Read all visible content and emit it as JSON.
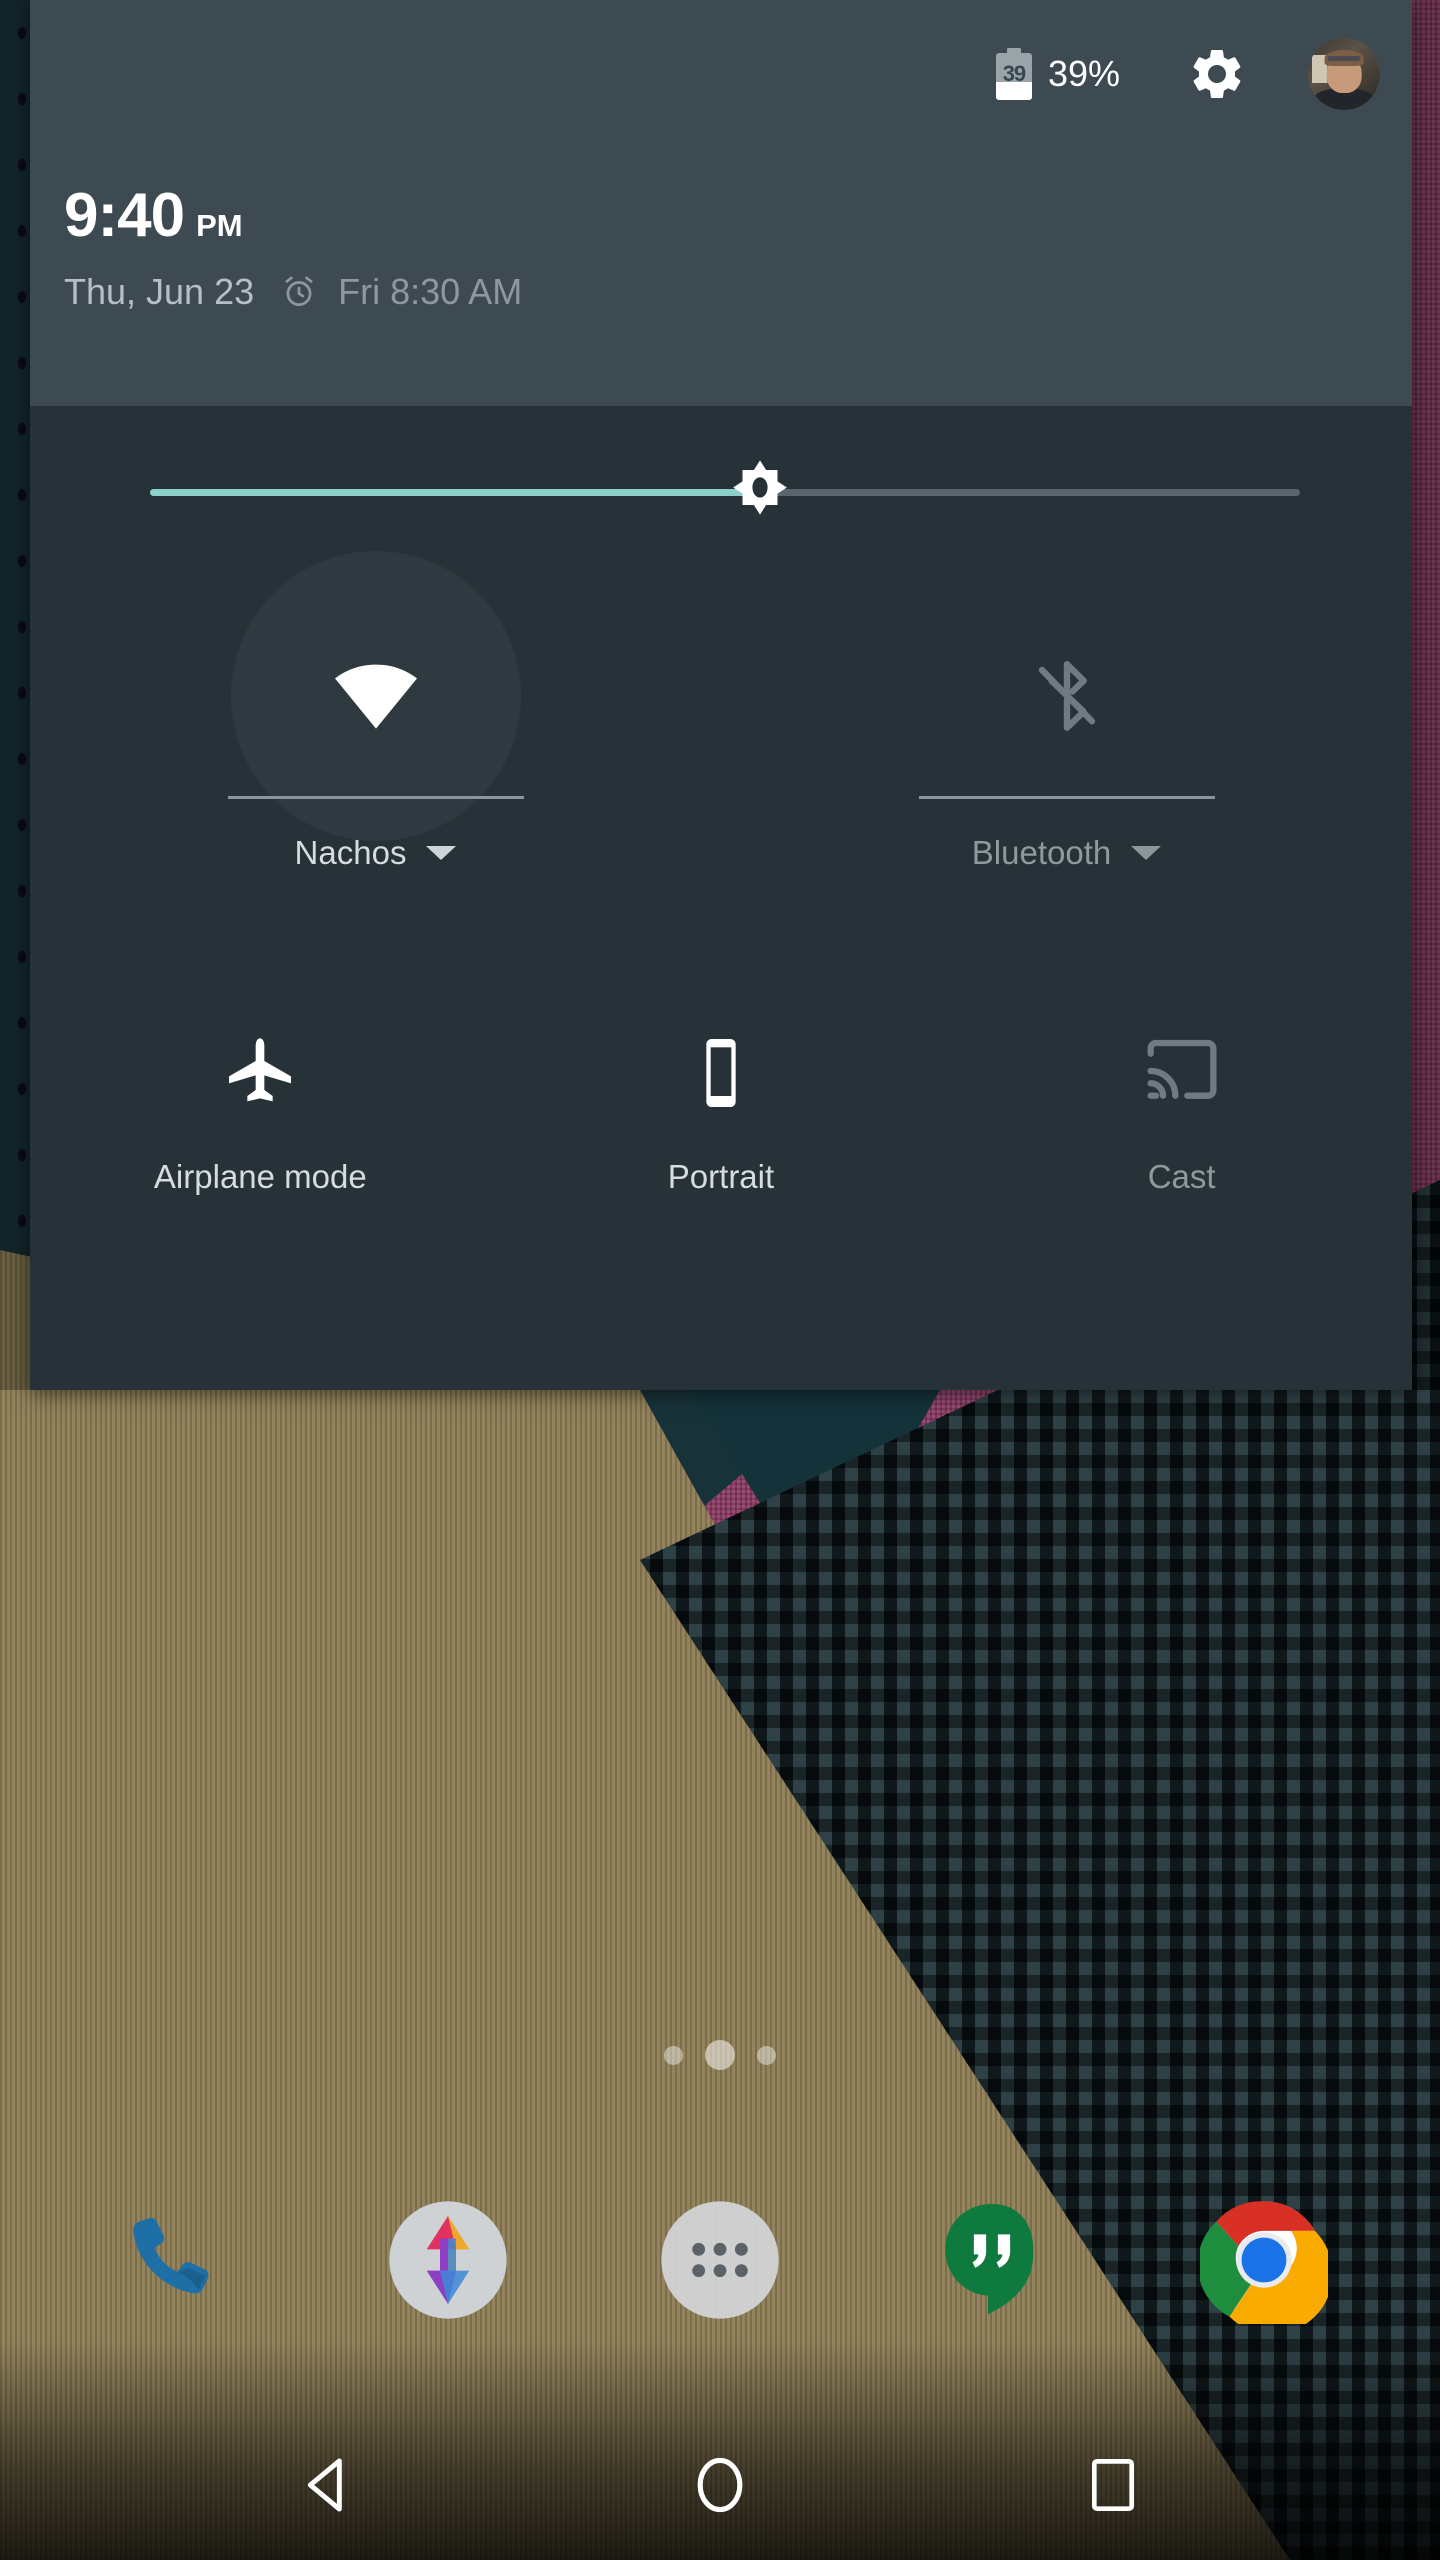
{
  "statusbar": {
    "battery_level_text": "39",
    "battery_percent_label": "39%",
    "gear_icon": "gear-icon",
    "avatar_icon": "user-avatar"
  },
  "clock": {
    "time": "9:40",
    "ampm": "PM",
    "date": "Thu, Jun 23",
    "alarm_icon": "alarm-clock-icon",
    "alarm_text": "Fri 8:30 AM"
  },
  "brightness": {
    "icon": "brightness-sun-icon",
    "value_percent": 53
  },
  "tiles_row1": [
    {
      "id": "wifi",
      "label": "Nachos",
      "icon": "wifi-icon",
      "enabled": true,
      "has_caret": true
    },
    {
      "id": "bluetooth",
      "label": "Bluetooth",
      "icon": "bluetooth-off-icon",
      "enabled": false,
      "has_caret": true
    }
  ],
  "tiles_row2": [
    {
      "id": "airplane",
      "label": "Airplane mode",
      "icon": "airplane-icon",
      "enabled": true
    },
    {
      "id": "rotation",
      "label": "Portrait",
      "icon": "phone-portrait-icon",
      "enabled": true
    },
    {
      "id": "cast",
      "label": "Cast",
      "icon": "cast-icon",
      "enabled": false
    }
  ],
  "home": {
    "page_dots": [
      {
        "active": false
      },
      {
        "active": true
      },
      {
        "active": false
      }
    ],
    "dock": [
      {
        "id": "phone",
        "icon": "phone-icon"
      },
      {
        "id": "photos",
        "icon": "photos-icon"
      },
      {
        "id": "app-drawer",
        "icon": "app-drawer-icon"
      },
      {
        "id": "hangouts",
        "icon": "hangouts-icon"
      },
      {
        "id": "chrome",
        "icon": "chrome-icon"
      }
    ]
  },
  "navbar": [
    {
      "id": "back",
      "icon": "back-triangle-icon"
    },
    {
      "id": "home",
      "icon": "home-circle-icon"
    },
    {
      "id": "recents",
      "icon": "recents-square-icon"
    }
  ],
  "colors": {
    "panel_body": "#263238",
    "panel_header": "#3e4a52",
    "slider_active": "#8dcfc9",
    "slider_track": "#5a666d",
    "label_on": "#d6dcdf",
    "label_off": "#90999e"
  }
}
